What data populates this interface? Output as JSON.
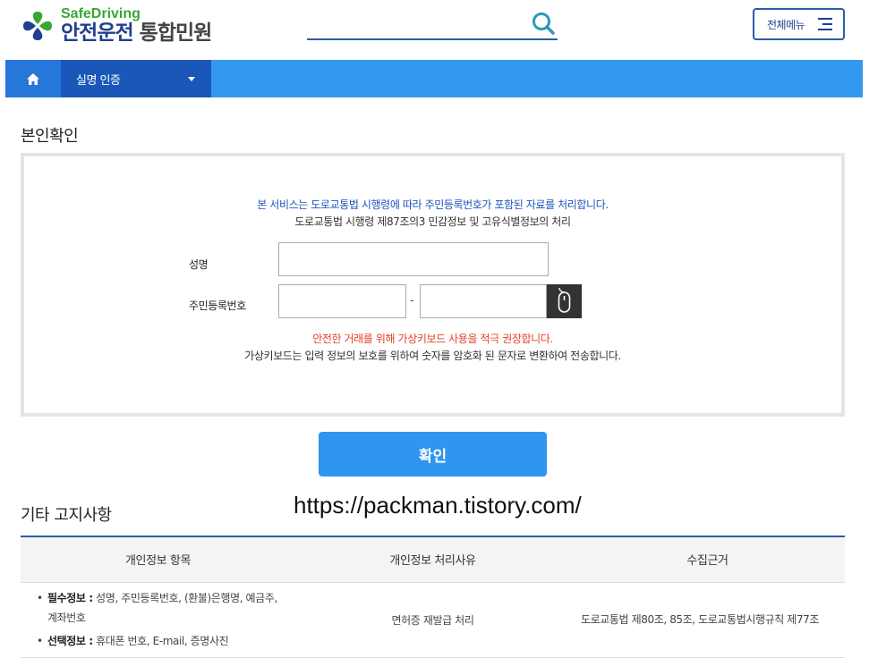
{
  "header": {
    "logo_en": "SafeDriving",
    "logo_ko_main": "안전운전",
    "logo_ko_sub": "통합민원",
    "search_placeholder": "",
    "menu_label": "전체메뉴"
  },
  "nav": {
    "home_icon": "home-icon",
    "dropdown_label": "실명 인증"
  },
  "verify": {
    "section_title": "본인확인",
    "notice_blue": "본 서비스는 도로교통법 시행령에 따라 주민등록번호가 포함된 자료를 처리합니다.",
    "notice_sub": "도로교통법 시행령 제87조의3 민감정보 및 고유식별정보의 처리",
    "name_label": "성명",
    "name_value": "",
    "rrn_label": "주민등록번호",
    "rrn_front_value": "",
    "rrn_back_value": "",
    "rrn_dash": "-",
    "keyboard_icon": "mouse-icon",
    "notice_red": "안전한 거래를 위해 가상키보드 사용을 적극 권장합니다.",
    "notice_info": "가상키보드는 입력 정보의 보호를 위하여 숫자를 암호화 된 문자로 변환하여 전송합니다.",
    "confirm_label": "확인"
  },
  "watermark": "https://packman.tistory.com/",
  "etc": {
    "title": "기타 고지사항",
    "headers": [
      "개인정보 항목",
      "개인정보 처리사유",
      "수집근거"
    ],
    "required_label": "필수정보 :",
    "required_text": " 성명, 주민등록번호, (환불)은행명, 예금주, 계좌번호",
    "optional_label": "선택정보 :",
    "optional_text": " 휴대폰 번호, E-mail, 증명사진",
    "reason": "면허증 재발급 처리",
    "basis": "도로교통법 제80조, 85조, 도로교통법시행규칙 제77조"
  },
  "colors": {
    "brand_blue": "#1f3f8f",
    "brand_green": "#3aa635",
    "nav_blue": "#3399ee",
    "button_blue": "#2f96f0",
    "warning_red": "#e5412b"
  }
}
